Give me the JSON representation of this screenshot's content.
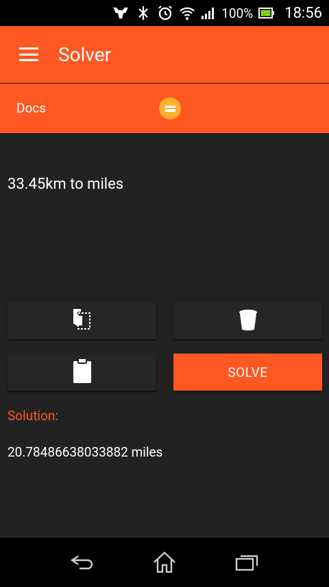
{
  "status_bar": {
    "battery_percent": "100%",
    "time": "18:56",
    "icons": [
      "notification-icon",
      "bluetooth-off-icon",
      "alarm-icon",
      "wifi-icon",
      "signal-icon",
      "battery-icon"
    ]
  },
  "app_bar": {
    "title": "Solver",
    "menu_icon": "hamburger-menu-icon"
  },
  "tabs": {
    "items": [
      {
        "label": "Docs",
        "selected": false
      },
      {
        "icon": "equals-icon",
        "selected": true
      }
    ]
  },
  "main": {
    "query": "33.45km to miles",
    "buttons": {
      "copy_icon": "copy-icon",
      "delete_icon": "trash-icon",
      "paste_icon": "clipboard-icon",
      "solve_label": "SOLVE"
    },
    "solution_label": "Solution:",
    "solution_value": "20.78486638033882 miles"
  },
  "nav_bar": {
    "icons": [
      "back-icon",
      "home-icon",
      "recents-icon"
    ]
  },
  "colors": {
    "accent": "#ff5722",
    "accent_secondary": "#ffb030",
    "background": "#222222",
    "button_bg": "#262626"
  }
}
